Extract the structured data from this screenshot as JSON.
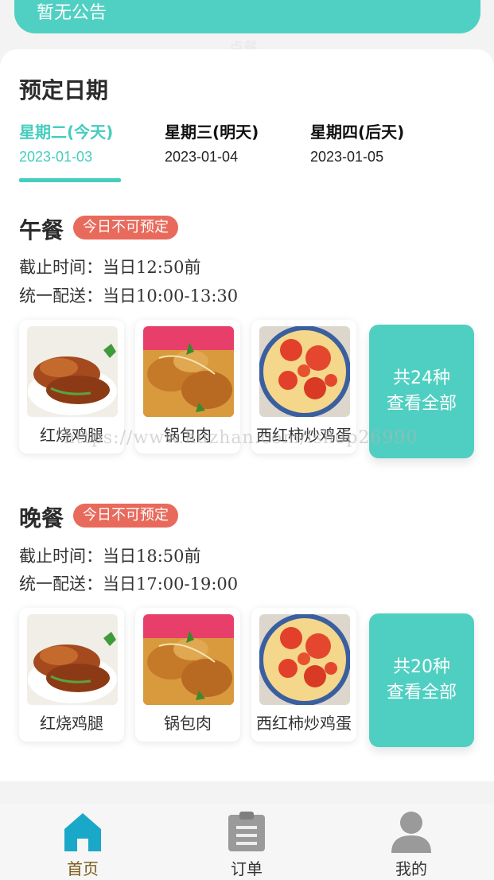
{
  "notice": {
    "text": "暂无公告",
    "faded_label": "点餐"
  },
  "booking": {
    "title": "预定日期",
    "dates": [
      {
        "day": "星期二(今天)",
        "date": "2023-01-03",
        "active": true
      },
      {
        "day": "星期三(明天)",
        "date": "2023-01-04",
        "active": false
      },
      {
        "day": "星期四(后天)",
        "date": "2023-01-05",
        "active": false
      }
    ]
  },
  "meals": [
    {
      "name": "午餐",
      "badge": "今日不可预定",
      "deadline": "截止时间：当日12:50前",
      "delivery": "统一配送：当日10:00-13:30",
      "dishes": [
        "红烧鸡腿",
        "锅包肉",
        "西红柿炒鸡蛋"
      ],
      "count_label": "共24种",
      "view_all": "查看全部"
    },
    {
      "name": "晚餐",
      "badge": "今日不可预定",
      "deadline": "截止时间：当日18:50前",
      "delivery": "统一配送：当日17:00-19:00",
      "dishes": [
        "红烧鸡腿",
        "锅包肉",
        "西红柿炒鸡蛋"
      ],
      "count_label": "共20种",
      "view_all": "查看全部"
    }
  ],
  "watermark": "https://www.huzhan.com/ishop26990",
  "tabbar": {
    "items": [
      {
        "label": "首页",
        "icon": "home-icon",
        "active": true
      },
      {
        "label": "订单",
        "icon": "clipboard-icon",
        "active": false
      },
      {
        "label": "我的",
        "icon": "user-icon",
        "active": false
      }
    ]
  },
  "colors": {
    "accent": "#45cdbe",
    "badge": "#e86a5c",
    "tab_active": "#1aa8c8"
  }
}
